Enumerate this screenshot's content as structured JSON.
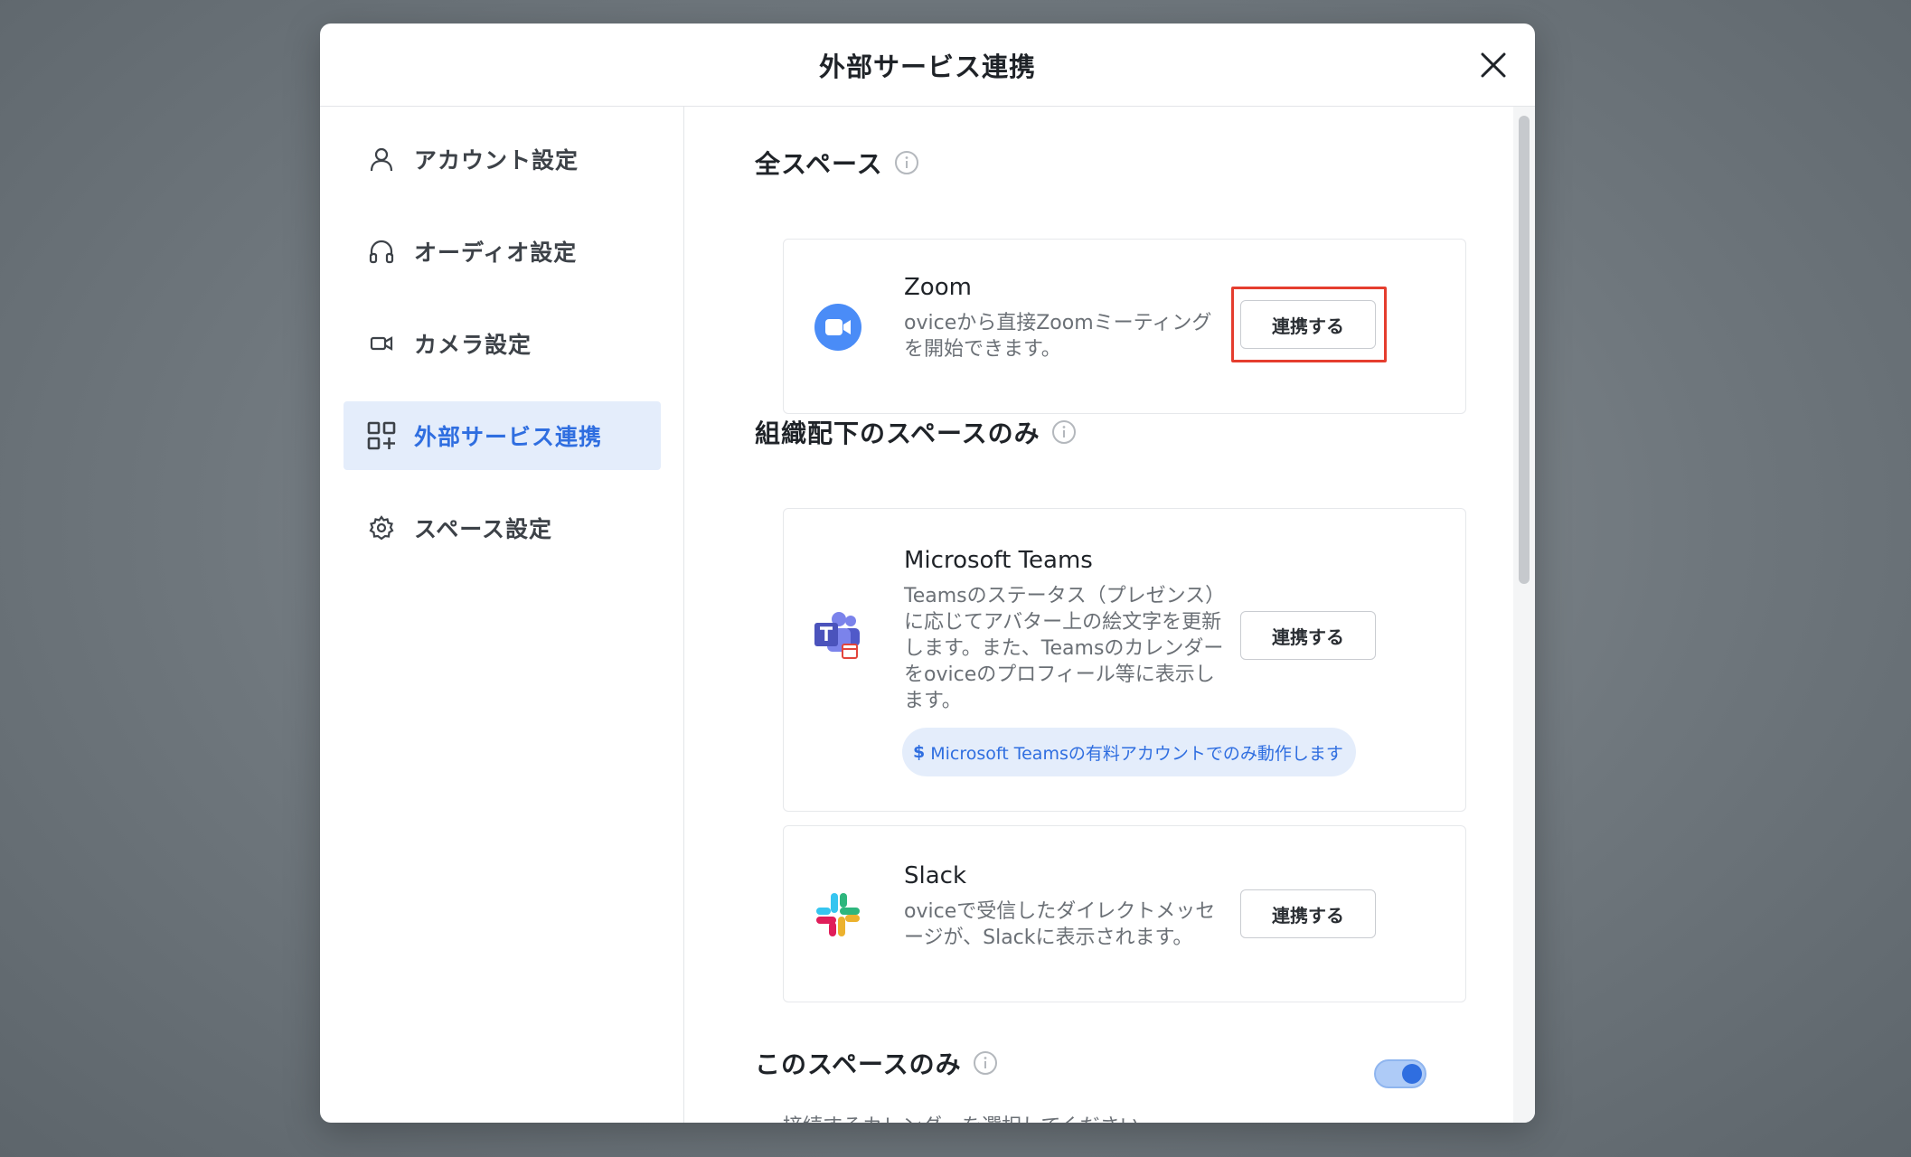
{
  "modal": {
    "title": "外部サービス連携"
  },
  "sidebar": {
    "items": [
      {
        "label": "アカウント設定",
        "icon": "person-icon"
      },
      {
        "label": "オーディオ設定",
        "icon": "headphones-icon"
      },
      {
        "label": "カメラ設定",
        "icon": "video-camera-icon"
      },
      {
        "label": "外部サービス連携",
        "icon": "apps-grid-icon",
        "active": true
      },
      {
        "label": "スペース設定",
        "icon": "gear-icon"
      }
    ]
  },
  "sections": {
    "all_spaces": {
      "title": "全スペース",
      "services": [
        {
          "name": "Zoom",
          "description": "oviceから直接Zoomミーティングを開始できます。",
          "button": "連携する",
          "icon": "zoom-logo-icon"
        }
      ]
    },
    "org_spaces": {
      "title": "組織配下のスペースのみ",
      "services": [
        {
          "name": "Microsoft Teams",
          "description": "Teamsのステータス（プレゼンス）に応じてアバター上の絵文字を更新します。また、Teamsのカレンダーをoviceのプロフィール等に表示します。",
          "button": "連携する",
          "icon": "teams-logo-icon",
          "note": "Microsoft Teamsの有料アカウントでのみ動作します"
        },
        {
          "name": "Slack",
          "description": "oviceで受信したダイレクトメッセージが、Slackに表示されます。",
          "button": "連携する",
          "icon": "slack-logo-icon"
        }
      ]
    },
    "this_space": {
      "title": "このスペースのみ",
      "calendar_prompt": "接続するカレンダーを選択してください",
      "toggle_on": true
    }
  },
  "colors": {
    "accent": "#2f6ee0",
    "highlight": "#e53d2e",
    "active_bg": "#e4edfb"
  }
}
